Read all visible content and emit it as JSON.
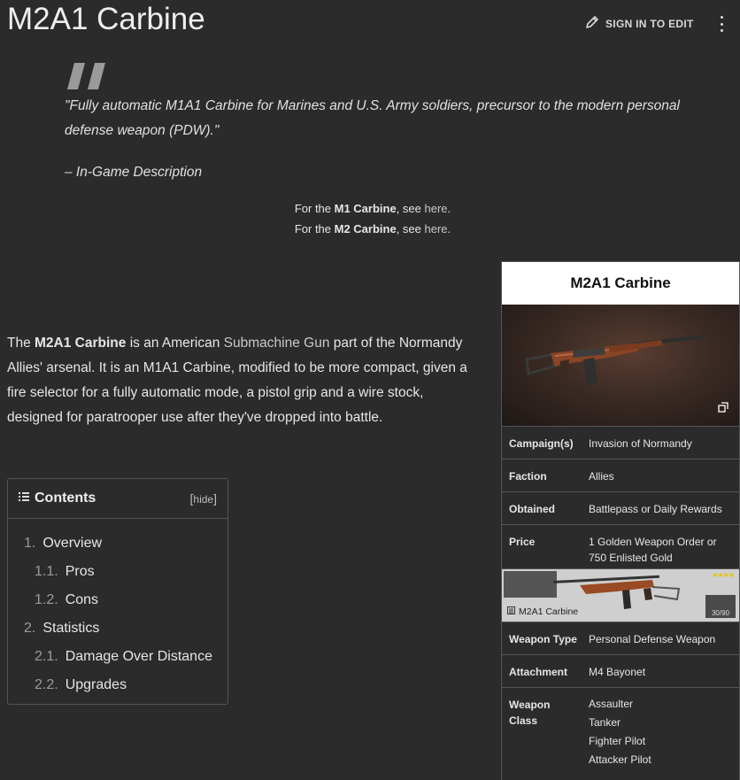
{
  "page": {
    "title": "M2A1 Carbine",
    "edit_label": "SIGN IN TO EDIT"
  },
  "quote": {
    "text": "\"Fully automatic M1A1 Carbine for Marines and U.S. Army soldiers, precursor to the modern personal defense weapon (PDW).\"",
    "source": "– In-Game Description"
  },
  "hatnotes": [
    {
      "prefix": "For the ",
      "subject": "M1 Carbine",
      "middle": ", see ",
      "link": "here",
      "suffix": "."
    },
    {
      "prefix": "For the ",
      "subject": "M2 Carbine",
      "middle": ", see ",
      "link": "here",
      "suffix": "."
    }
  ],
  "intro": {
    "p1": "The ",
    "name": "M2A1 Carbine",
    "p2": " is an American ",
    "link": "Submachine Gun",
    "p3": " part of the Normandy Allies' arsenal. It is an M1A1 Carbine, modified to be more compact, given a fire selector for a fully automatic mode, a pistol grip and a wire stock, designed for paratrooper use after they've dropped into battle."
  },
  "toc": {
    "title": "Contents",
    "hide_open": "[",
    "hide_label": "hide",
    "hide_close": "]",
    "items": [
      {
        "num": "1.",
        "label": "Overview"
      },
      {
        "num": "1.1.",
        "label": "Pros"
      },
      {
        "num": "1.2.",
        "label": "Cons"
      },
      {
        "num": "2.",
        "label": "Statistics"
      },
      {
        "num": "2.1.",
        "label": "Damage Over Distance"
      },
      {
        "num": "2.2.",
        "label": "Upgrades"
      }
    ]
  },
  "infobox": {
    "title": "M2A1 Carbine",
    "rows": [
      {
        "label": "Campaign(s)",
        "value": "Invasion of Normandy"
      },
      {
        "label": "Faction",
        "value": "Allies"
      },
      {
        "label": "Obtained",
        "value": "Battlepass or Daily Rewards"
      },
      {
        "label": "Price",
        "value1": "1 Golden Weapon Order or",
        "value2": "750 Enlisted Gold"
      },
      {
        "label": "Weapon Type",
        "value": "Personal Defense Weapon"
      },
      {
        "label": "Attachment",
        "value": "M4 Bayonet"
      },
      {
        "label1": "Weapon",
        "label2": "Class",
        "values": [
          "Assaulter",
          "Tanker",
          "Fighter Pilot",
          "Attacker Pilot"
        ]
      }
    ],
    "card": {
      "name": "M2A1 Carbine",
      "stars": "★★★★",
      "ammo": "30/90"
    }
  },
  "colors": {
    "background": "#2b2b2b",
    "text": "#e6e6e6",
    "border": "#555555",
    "infobox_title_bg": "#ffffff"
  }
}
